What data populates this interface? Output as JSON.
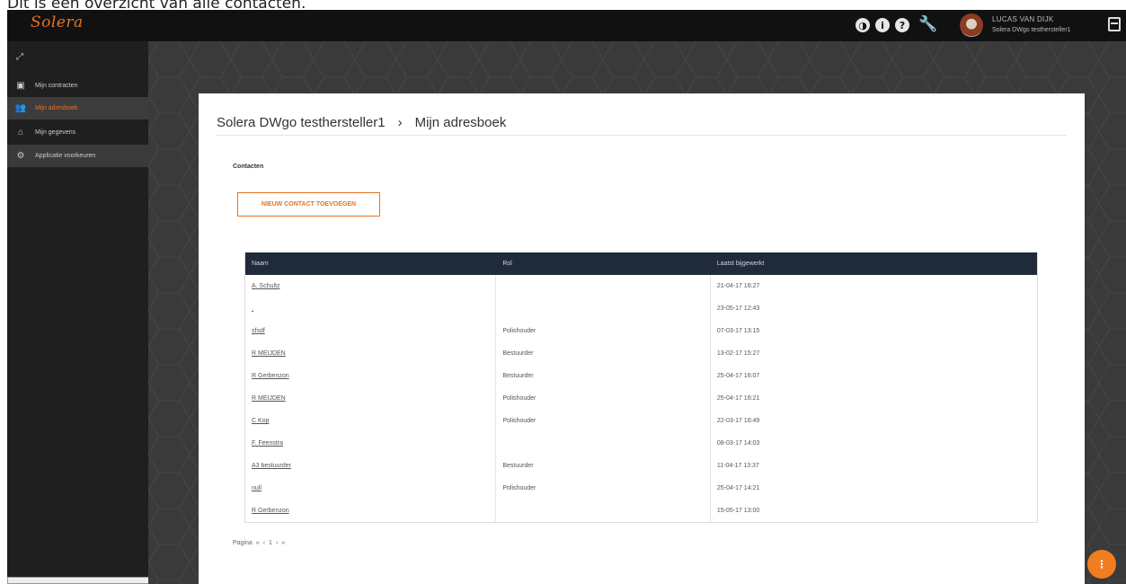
{
  "caption": "Dit is een overzicht van alle contacten.",
  "app": {
    "logo": "Solera"
  },
  "topbar": {
    "icons": [
      "contrast-icon",
      "info-icon",
      "help-icon",
      "wrench-icon"
    ],
    "user_name": "LUCAS VAN DIJK",
    "user_company": "Solera DWgo testhersteller1"
  },
  "sidebar": {
    "items": [
      {
        "label": "Mijn contracten",
        "icon": "contracts-icon"
      },
      {
        "label": "Mijn adresboek",
        "icon": "addressbook-icon"
      },
      {
        "label": "Mijn gegevens",
        "icon": "home-icon"
      },
      {
        "label": "Applicatie voorkeuren",
        "icon": "gear-icon"
      }
    ]
  },
  "main": {
    "breadcrumb": {
      "company": "Solera DWgo testhersteller1",
      "separator": "›",
      "page": "Mijn adresboek"
    },
    "section_title": "Contacten",
    "new_contact_button": "NIEUW CONTACT TOEVOEGEN",
    "table": {
      "headers": [
        "Naam",
        "Rol",
        "Laatst bijgewerkt"
      ],
      "rows": [
        {
          "naam": "A. Schultz",
          "rol": "",
          "date": "21-04-17 16:27"
        },
        {
          "naam": ".",
          "rol": "",
          "date": "23-05-17 12:43"
        },
        {
          "naam": "sfsdf",
          "rol": "Polishouder",
          "date": "07-03-17 13:15"
        },
        {
          "naam": "R MEIJDEN",
          "rol": "Bestuurder",
          "date": "13-02-17 15:27"
        },
        {
          "naam": "R Gerbenzon",
          "rol": "Bestuurder",
          "date": "25-04-17 16:07"
        },
        {
          "naam": "R MEIJDEN",
          "rol": "Polishouder",
          "date": "25-04-17 16:21"
        },
        {
          "naam": "C Kop",
          "rol": "Polishouder",
          "date": "22-03-17 16:49"
        },
        {
          "naam": "F. Feenstra",
          "rol": "",
          "date": "08-03-17 14:03"
        },
        {
          "naam": "A3 bestuurder",
          "rol": "Bestuurder",
          "date": "11-04-17 13:37"
        },
        {
          "naam": "null",
          "rol": "Polishouder",
          "date": "25-04-17 14:21"
        },
        {
          "naam": "R Gerbenzon",
          "rol": "",
          "date": "15-05-17 13:00"
        }
      ]
    },
    "pagination": {
      "label": "Pagina",
      "first": "«",
      "prev": "‹",
      "current": "1",
      "next": "›",
      "last": "»"
    }
  },
  "colors": {
    "accent": "#e8731f",
    "topbar": "#111111",
    "sidebar": "#1f1f1f",
    "table_header": "#1f2a3a"
  }
}
